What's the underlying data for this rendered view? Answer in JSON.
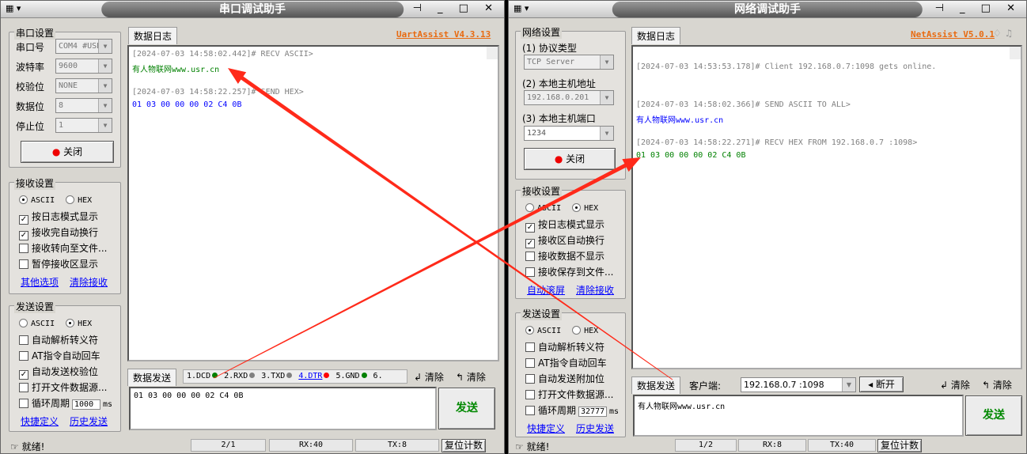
{
  "uart": {
    "title": "串口调试助手",
    "version": "UartAssist V4.3.13",
    "serial_group": "串口设置",
    "fields": [
      {
        "label": "串口号",
        "value": "COM4 #USB"
      },
      {
        "label": "波特率",
        "value": "9600"
      },
      {
        "label": "校验位",
        "value": "NONE"
      },
      {
        "label": "数据位",
        "value": "8"
      },
      {
        "label": "停止位",
        "value": "1"
      }
    ],
    "close_button": "关闭",
    "recv_group": "接收设置",
    "recv_ascii": "ASCII",
    "recv_hex": "HEX",
    "recv_mode": "ASCII",
    "recv_options": [
      {
        "label": "按日志模式显示",
        "checked": true
      },
      {
        "label": "接收完自动换行",
        "checked": true
      },
      {
        "label": "接收转向至文件...",
        "checked": false
      },
      {
        "label": "暂停接收区显示",
        "checked": false
      }
    ],
    "recv_links": [
      "其他选项",
      "清除接收"
    ],
    "send_group": "发送设置",
    "send_ascii": "ASCII",
    "send_hex": "HEX",
    "send_mode": "HEX",
    "send_options": [
      {
        "label": "自动解析转义符",
        "checked": false
      },
      {
        "label": "AT指令自动回车",
        "checked": false
      },
      {
        "label": "自动发送校验位",
        "checked": true
      },
      {
        "label": "打开文件数据源...",
        "checked": false
      }
    ],
    "loop_label": "循环周期",
    "loop_value": "1000",
    "loop_unit": "ms",
    "send_links": [
      "快捷定义",
      "历史发送"
    ],
    "log_tab": "数据日志",
    "log": [
      {
        "text": "[2024-07-03 14:58:02.442]# RECV ASCII>",
        "color": "#808080"
      },
      {
        "text": "有人物联网www.usr.cn",
        "color": "#008000"
      },
      {
        "text": "",
        "color": "#000"
      },
      {
        "text": "[2024-07-03 14:58:22.257]# SEND HEX>",
        "color": "#808080"
      },
      {
        "text": "01 03 00 00 00 02 C4 0B",
        "color": "#0000ff"
      }
    ],
    "send_tab": "数据发送",
    "signals": [
      {
        "label": "1.DCD",
        "color": "#008000"
      },
      {
        "label": "2.RXD",
        "color": "#808080"
      },
      {
        "label": "3.TXD",
        "color": "#808080"
      },
      {
        "label": "4.DTR",
        "color": "#ff0000"
      },
      {
        "label": "5.GND",
        "color": "#008000"
      },
      {
        "label": "6.",
        "color": ""
      }
    ],
    "clear1": "清除",
    "clear2": "清除",
    "send_input": "01 03 00 00 00 02 C4 0B",
    "send_button": "发送",
    "status": "就绪!",
    "counter": "2/1",
    "rx": "RX:40",
    "tx": "TX:8",
    "reset": "复位计数"
  },
  "net": {
    "title": "网络调试助手",
    "version": "NetAssist V5.0.1",
    "net_group": "网络设置",
    "protocol_label": "(1) 协议类型",
    "protocol": "TCP Server",
    "host_label": "(2) 本地主机地址",
    "host": "192.168.0.201",
    "port_label": "(3) 本地主机端口",
    "port": "1234",
    "close_button": "关闭",
    "recv_group": "接收设置",
    "recv_ascii": "ASCII",
    "recv_hex": "HEX",
    "recv_mode": "HEX",
    "recv_options": [
      {
        "label": "按日志模式显示",
        "checked": true
      },
      {
        "label": "接收区自动换行",
        "checked": true
      },
      {
        "label": "接收数据不显示",
        "checked": false
      },
      {
        "label": "接收保存到文件...",
        "checked": false
      }
    ],
    "recv_links": [
      "自动滚屏",
      "清除接收"
    ],
    "send_group": "发送设置",
    "send_ascii": "ASCII",
    "send_hex": "HEX",
    "send_mode": "ASCII",
    "send_options": [
      {
        "label": "自动解析转义符",
        "checked": false
      },
      {
        "label": "AT指令自动回车",
        "checked": false
      },
      {
        "label": "自动发送附加位",
        "checked": false
      },
      {
        "label": "打开文件数据源...",
        "checked": false
      }
    ],
    "loop_label": "循环周期",
    "loop_value": "32777",
    "loop_unit": "ms",
    "send_links": [
      "快捷定义",
      "历史发送"
    ],
    "log_tab": "数据日志",
    "log": [
      {
        "text": "",
        "color": "#000"
      },
      {
        "text": "[2024-07-03 14:53:53.178]# Client 192.168.0.7:1098 gets online.",
        "color": "#808080"
      },
      {
        "text": "",
        "color": "#000"
      },
      {
        "text": "",
        "color": "#000"
      },
      {
        "text": "[2024-07-03 14:58:02.366]# SEND ASCII TO ALL>",
        "color": "#808080"
      },
      {
        "text": "有人物联网www.usr.cn",
        "color": "#0000ff"
      },
      {
        "text": "",
        "color": "#000"
      },
      {
        "text": "[2024-07-03 14:58:22.271]# RECV HEX FROM 192.168.0.7 :1098>",
        "color": "#808080"
      },
      {
        "text": "01 03 00 00 00 02 C4 0B",
        "color": "#008000"
      }
    ],
    "send_tab": "数据发送",
    "client_label": "客户端:",
    "client": "192.168.0.7 :1098",
    "disconnect": "断开",
    "clear1": "清除",
    "clear2": "清除",
    "send_input": "有人物联网www.usr.cn",
    "send_button": "发送",
    "status": "就绪!",
    "counter": "1/2",
    "rx": "RX:8",
    "tx": "TX:40",
    "reset": "复位计数"
  },
  "annotation_color": "#ff2a1a"
}
